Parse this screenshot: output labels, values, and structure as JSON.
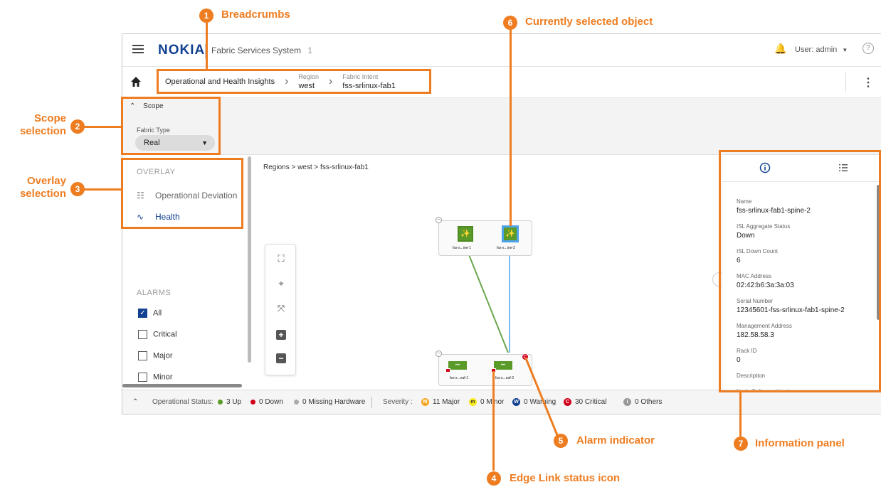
{
  "app": {
    "brand": "NOKIA",
    "name": "Fabric Services System",
    "name_suffix": "1",
    "user": "User: admin",
    "help_glyph": "?"
  },
  "breadcrumbs": [
    {
      "caption": "",
      "label": "Operational and Health Insights"
    },
    {
      "caption": "Region",
      "label": "west"
    },
    {
      "caption": "Fabric Intent",
      "label": "fss-srlinux-fab1"
    }
  ],
  "scope": {
    "toggle_label": "Scope",
    "fabric_type_label": "Fabric Type",
    "fabric_type_value": "Real"
  },
  "overlay": {
    "title": "OVERLAY",
    "items": [
      {
        "label": "Operational Deviation",
        "icon": "hierarchy-icon",
        "active": false
      },
      {
        "label": "Health",
        "icon": "pulse-icon",
        "active": true
      }
    ]
  },
  "alarms": {
    "title": "ALARMS",
    "filters": [
      {
        "label": "All",
        "checked": true
      },
      {
        "label": "Critical",
        "checked": false
      },
      {
        "label": "Major",
        "checked": false
      },
      {
        "label": "Minor",
        "checked": false
      }
    ]
  },
  "canvas": {
    "breadcrumb": "Regions > west > fss-srlinux-fab1",
    "spine_nodes": [
      "fss-s...ine-1",
      "fss-s...ine-2"
    ],
    "leaf_nodes": [
      "fss-s...eaf-1",
      "fss-s...eaf-2"
    ],
    "alarm_glyph": "C"
  },
  "info_panel": {
    "fields": [
      {
        "key": "Name",
        "value": "fss-srlinux-fab1-spine-2"
      },
      {
        "key": "ISL Aggregate Status",
        "value": "Down"
      },
      {
        "key": "ISL Down Count",
        "value": "6"
      },
      {
        "key": "MAC Address",
        "value": "02:42:b6:3a:3a:03"
      },
      {
        "key": "Serial Number",
        "value": "12345601-fss-srlinux-fab1-spine-2"
      },
      {
        "key": "Management Address",
        "value": "182.58.58.3"
      },
      {
        "key": "Rack ID",
        "value": "0"
      },
      {
        "key": "Description",
        "value": ""
      },
      {
        "key": "Node Software Version",
        "value": ""
      }
    ]
  },
  "status_bar": {
    "operational_label": "Operational Status:",
    "up": "3 Up",
    "down": "0 Down",
    "missing": "0 Missing Hardware",
    "severity_label": "Severity :",
    "major": "11 Major",
    "minor": "0 Minor",
    "warning": "0 Warning",
    "critical": "30 Critical",
    "others": "0 Others",
    "major_glyph": "M",
    "minor_glyph": "m",
    "warning_glyph": "W",
    "critical_glyph": "C",
    "others_glyph": "i"
  },
  "callouts": [
    {
      "num": "1",
      "label": "Breadcrumbs"
    },
    {
      "num": "2",
      "label": "Scope selection"
    },
    {
      "num": "3",
      "label": "Overlay selection"
    },
    {
      "num": "4",
      "label": "Edge Link status icon"
    },
    {
      "num": "5",
      "label": "Alarm indicator"
    },
    {
      "num": "6",
      "label": "Currently selected object"
    },
    {
      "num": "7",
      "label": "Information panel"
    }
  ],
  "colors": {
    "annotation": "#ee7d21",
    "nokia_blue": "#124191",
    "node_green": "#5a9a28",
    "selected_link": "#4da3ea",
    "critical": "#d0021b",
    "major": "#f5a623",
    "minor": "#f8e71c",
    "warning": "#124191",
    "up": "#5a9a28",
    "down": "#d0021b",
    "missing": "#aaaaaa",
    "others": "#999999"
  }
}
